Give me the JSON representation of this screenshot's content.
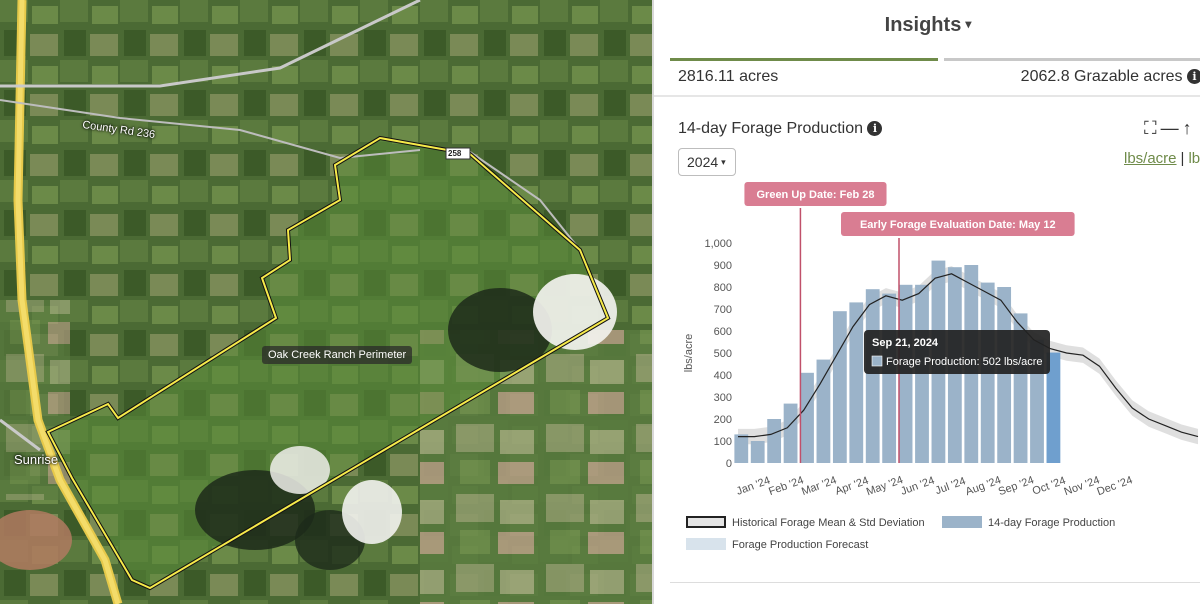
{
  "map": {
    "road_labels": [
      "County Rd 236",
      "258",
      "Sunrise"
    ],
    "perimeter_label": "Oak Creek Ranch Perimeter"
  },
  "insights": {
    "title": "Insights",
    "caret": "▾",
    "acres": "2816.11 acres",
    "grazable": "2062.8 Grazable acres",
    "info_icon": "i"
  },
  "forage": {
    "title": "14-day Forage Production",
    "year": "2024",
    "units_active": "lbs/acre",
    "units_other": "lb",
    "tools": [
      "⛶",
      "—",
      "↑"
    ]
  },
  "chart_data": {
    "type": "bar",
    "ylabel": "lbs/acre",
    "ylim": [
      0,
      1000
    ],
    "yticks": [
      "0",
      "100",
      "200",
      "300",
      "400",
      "500",
      "600",
      "700",
      "800",
      "900",
      "1,000"
    ],
    "month_labels": [
      "Jan '24",
      "Feb '24",
      "Mar '24",
      "Apr '24",
      "May '24",
      "Jun '24",
      "Jul '24",
      "Aug '24",
      "Sep '24",
      "Oct '24",
      "Nov '24",
      "Dec '24"
    ],
    "bars": [
      {
        "t": 0.1,
        "v": 130
      },
      {
        "t": 0.6,
        "v": 100
      },
      {
        "t": 1.1,
        "v": 200
      },
      {
        "t": 1.6,
        "v": 270
      },
      {
        "t": 2.1,
        "v": 410
      },
      {
        "t": 2.6,
        "v": 470
      },
      {
        "t": 3.1,
        "v": 690
      },
      {
        "t": 3.6,
        "v": 730
      },
      {
        "t": 4.1,
        "v": 790
      },
      {
        "t": 4.6,
        "v": 770
      },
      {
        "t": 5.1,
        "v": 810
      },
      {
        "t": 5.6,
        "v": 810
      },
      {
        "t": 6.1,
        "v": 920
      },
      {
        "t": 6.6,
        "v": 890
      },
      {
        "t": 7.1,
        "v": 900
      },
      {
        "t": 7.6,
        "v": 820
      },
      {
        "t": 8.1,
        "v": 800
      },
      {
        "t": 8.6,
        "v": 680
      },
      {
        "t": 9.1,
        "v": 560
      },
      {
        "t": 9.6,
        "v": 502
      }
    ],
    "mean": [
      [
        0,
        120
      ],
      [
        0.5,
        120
      ],
      [
        1,
        130
      ],
      [
        1.5,
        160
      ],
      [
        2,
        240
      ],
      [
        2.5,
        360
      ],
      [
        3,
        490
      ],
      [
        3.5,
        620
      ],
      [
        4,
        720
      ],
      [
        4.5,
        760
      ],
      [
        5,
        740
      ],
      [
        5.5,
        770
      ],
      [
        6,
        840
      ],
      [
        6.5,
        860
      ],
      [
        7,
        820
      ],
      [
        7.5,
        780
      ],
      [
        8,
        740
      ],
      [
        8.5,
        640
      ],
      [
        9,
        560
      ],
      [
        9.5,
        520
      ],
      [
        10,
        500
      ],
      [
        10.5,
        490
      ],
      [
        11,
        440
      ],
      [
        11.5,
        340
      ],
      [
        12,
        250
      ],
      [
        12.5,
        200
      ],
      [
        13,
        170
      ],
      [
        13.5,
        140
      ],
      [
        14,
        120
      ]
    ],
    "std_band": 35,
    "markers": [
      {
        "t": 1.9,
        "label": "Green Up Date: Feb 28"
      },
      {
        "t": 4.9,
        "label": "Early Forage Evaluation Date: May 12"
      }
    ],
    "tooltip": {
      "date": "Sep 21, 2024",
      "label": "Forage Production: 502 lbs/acre",
      "t": 9.6
    },
    "legend": [
      "Historical Forage Mean & Std Deviation",
      "14-day Forage Production",
      "Forage Production Forecast"
    ],
    "colors": {
      "bar": "#9bb3c9",
      "bar_highlight": "#6f9fce",
      "marker": "#c0506a",
      "marker_bg": "#d97d92",
      "forecast": "#d8e3ec",
      "std": "#d4d4d4",
      "mean": "#222222"
    }
  }
}
